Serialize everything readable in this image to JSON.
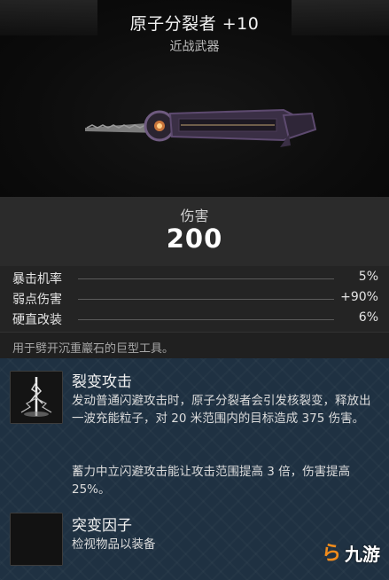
{
  "item": {
    "name": "原子分裂者 +10",
    "type": "近战武器"
  },
  "damage": {
    "label": "伤害",
    "value": "200"
  },
  "stats": [
    {
      "label": "暴击机率",
      "value": "5%"
    },
    {
      "label": "弱点伤害",
      "value": "+90%"
    },
    {
      "label": "硬直改装",
      "value": "6%"
    }
  ],
  "description": "用于劈开沉重巖石的巨型工具。",
  "mods": [
    {
      "title": "裂变攻击",
      "text": "发动普通闪避攻击时，原子分裂者会引发核裂变，释放出一波充能粒子，对 20 米范围内的目标造成 375 伤害。",
      "text2": "蓄力中立闪避攻击能让攻击范围提高 3 倍，伤害提高 25%。",
      "icon": "lightning-icon"
    },
    {
      "title": "突变因子",
      "text": "检视物品以装备",
      "icon": "empty-slot-icon"
    }
  ],
  "watermark": {
    "glyph": "ら",
    "text": "九游"
  },
  "colors": {
    "panel": "#1f3142",
    "damage_bg": "#2b2b2b",
    "watermark_orange": "#f28c1c"
  }
}
